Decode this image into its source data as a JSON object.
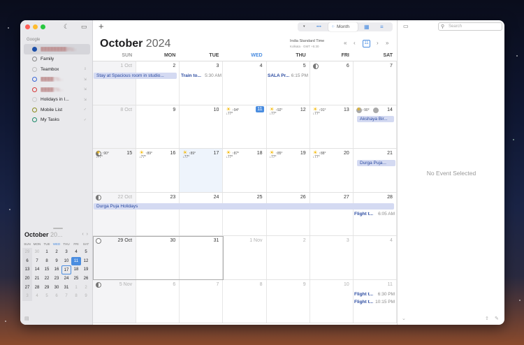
{
  "sidebar": {
    "group": "Google",
    "calendars": [
      {
        "name": "████████@g...",
        "color": "#1c4fa8",
        "blur": true,
        "flag": "",
        "selected": true
      },
      {
        "name": "Family",
        "color": "#888888",
        "blur": false,
        "flag": ""
      },
      {
        "name": "Teambox",
        "color": "#bdbdbd",
        "blur": false,
        "flag": "⇩"
      },
      {
        "name": "████ Ta...",
        "color": "#3a66d6",
        "blur": true,
        "flag": "⇲"
      },
      {
        "name": "████ Ta...",
        "color": "#d63a3a",
        "blur": true,
        "flag": "⇲"
      },
      {
        "name": "Holidays in I...",
        "color": "#cccccc",
        "blur": false,
        "flag": "⇲"
      },
      {
        "name": "Mobile List",
        "color": "#8a8a1c",
        "blur": false,
        "flag": "✓"
      },
      {
        "name": "My Tasks",
        "color": "#1c8a6a",
        "blur": false,
        "flag": "✓"
      }
    ],
    "mini": {
      "month": "October",
      "year": "20...",
      "prev": "‹",
      "next": "›",
      "dows": [
        "SUN",
        "MON",
        "TUE",
        "WED",
        "THU",
        "FRI",
        "SAT"
      ],
      "weeks": [
        [
          "29",
          "30",
          "1",
          "2",
          "3",
          "4",
          "5"
        ],
        [
          "6",
          "7",
          "8",
          "9",
          "10",
          "11",
          "12"
        ],
        [
          "13",
          "14",
          "15",
          "16",
          "17",
          "18",
          "19"
        ],
        [
          "20",
          "21",
          "22",
          "23",
          "24",
          "25",
          "26"
        ],
        [
          "27",
          "28",
          "29",
          "30",
          "31",
          "1",
          "2"
        ],
        [
          "3",
          "4",
          "5",
          "6",
          "7",
          "8",
          "9"
        ]
      ],
      "nov_label": "Nov"
    }
  },
  "toolbar": {
    "add": "+",
    "view_label": "Month",
    "more": "•••"
  },
  "header": {
    "month": "October",
    "year": "2024",
    "tz_name": "India Standard Time",
    "tz_detail": "Kolkata · GMT +5:30",
    "today_icon": "11"
  },
  "dows": [
    "SUN",
    "MON",
    "TUE",
    "WED",
    "THU",
    "FRI",
    "SAT"
  ],
  "weeks": [
    {
      "days": [
        "1 Oct",
        "2",
        "3",
        "4",
        "5",
        "6",
        "7"
      ]
    },
    {
      "days": [
        "8 Oct",
        "9",
        "10",
        "11",
        "12",
        "13",
        "14"
      ]
    },
    {
      "days": [
        "15",
        "16",
        "17",
        "18",
        "19",
        "20",
        "21"
      ]
    },
    {
      "days": [
        "22 Oct",
        "23",
        "24",
        "25",
        "26",
        "27",
        "28"
      ]
    },
    {
      "days": [
        "29 Oct",
        "30",
        "31",
        "1 Nov",
        "2",
        "3",
        "4"
      ]
    },
    {
      "days": [
        "5 Nov",
        "6",
        "7",
        "8",
        "9",
        "10",
        "11"
      ]
    }
  ],
  "weather": {
    "r1": [
      "↑94°",
      "↑92°",
      "↑91°",
      "↑90°"
    ],
    "r2": [
      "↑90°",
      "↑89°",
      "↑89°",
      "↑87°",
      "↑85°",
      "↑88°"
    ],
    "low": "↓77°"
  },
  "events": {
    "stay": "Stay at Spacious room in studio...",
    "train": "Train to...",
    "train_time": "5:30 AM",
    "sala": "SALA Pr...",
    "sala_time": "6:15 PM",
    "akshaya": "Akshaya Bir...",
    "durga1": "Durga Puja...",
    "durga2": "Durga Puja Holidays",
    "flight1": "Flight t...",
    "flight1_time": "6:05 AM",
    "flight2": "Flight t...",
    "flight2_time": "6:30 PM",
    "flight3": "Flight t...",
    "flight3_time": "10:15 PM"
  },
  "right": {
    "search_placeholder": "Search",
    "empty": "No Event Selected"
  }
}
